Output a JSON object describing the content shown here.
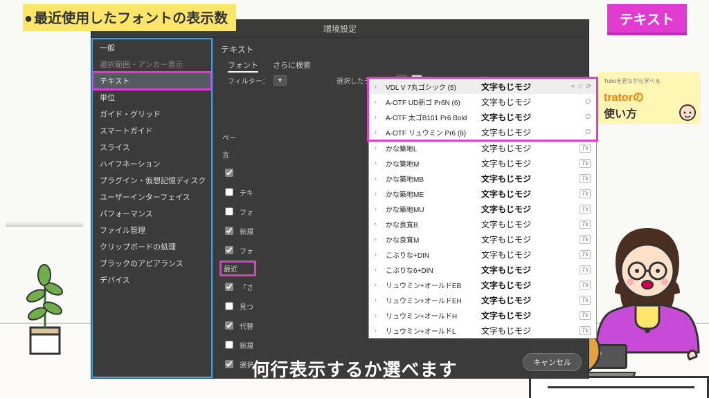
{
  "title_pill": "最近使用したフォントの表示数",
  "right_label": "テキスト",
  "app": {
    "title": "環境設定",
    "main_heading": "テキスト",
    "tabs": {
      "font": "フォント",
      "more": "さらに検索"
    },
    "filter": {
      "label": "フィルター：",
      "selected_text_label": "選択したテキスト"
    },
    "cancel": "キャンセル"
  },
  "sidebar": [
    "一般",
    "選択範囲・アンカー表示",
    "テキスト",
    "単位",
    "ガイド・グリッド",
    "スマートガイド",
    "スライス",
    "ハイフネーション",
    "プラグイン・仮想記憶ディスク",
    "ユーザーインターフェイス",
    "パフォーマンス",
    "ファイル管理",
    "クリップボードの処理",
    "ブラックのアピアランス",
    "デバイス"
  ],
  "sidebar_selected_index": 2,
  "options": [
    {
      "label": "ペー",
      "checked": false,
      "type": "text"
    },
    {
      "label": "言",
      "checked": false,
      "type": "text"
    },
    {
      "label": "",
      "checked": true
    },
    {
      "label": "テキ",
      "checked": false
    },
    {
      "label": "フォ",
      "checked": false
    },
    {
      "label": "新規",
      "checked": true
    },
    {
      "label": "フォ",
      "checked": true
    },
    {
      "label": "最近",
      "checked": false,
      "highlight": true,
      "type": "text"
    },
    {
      "label": "「さ",
      "checked": true
    },
    {
      "label": "見つ",
      "checked": false
    },
    {
      "label": "代替",
      "checked": true
    },
    {
      "label": "新規",
      "checked": false
    },
    {
      "label": "選択",
      "checked": true
    }
  ],
  "fonts": {
    "recent": [
      {
        "name": "VDL V 7丸ゴシック (5)",
        "sample": "文字もじモジ",
        "style": "sans bold",
        "tail": "≈ ☆ ⟳"
      },
      {
        "name": "A-OTF UD新ゴ Pr6N (6)",
        "sample": "文字もじモジ",
        "style": "sans",
        "tail": "O"
      },
      {
        "name": "A-OTF 太ゴB101 Pr6 Bold",
        "sample": "文字もじモジ",
        "style": "sans bold",
        "tail": "O"
      },
      {
        "name": "A-OTF リュウミン Pr6 (8)",
        "sample": "文字もじモジ",
        "style": "serif",
        "tail": "O"
      }
    ],
    "list": [
      {
        "name": "かな築地L",
        "sample": "文字もじモジ",
        "style": "serif"
      },
      {
        "name": "かな築地M",
        "sample": "文字もじモジ",
        "style": "serif"
      },
      {
        "name": "かな築地MB",
        "sample": "文字もじモジ",
        "style": "serif bold"
      },
      {
        "name": "かな築地ME",
        "sample": "文字もじモジ",
        "style": "serif bold"
      },
      {
        "name": "かな築地MU",
        "sample": "文字もじモジ",
        "style": "serif bold"
      },
      {
        "name": "かな良寛B",
        "sample": "文字もじモジ",
        "style": "serif"
      },
      {
        "name": "かな良寛M",
        "sample": "文字もじモジ",
        "style": "serif"
      },
      {
        "name": "こぶりな+DIN",
        "sample": "文字もじモジ",
        "style": "sans"
      },
      {
        "name": "こぶりな6+DIN",
        "sample": "文字もじモジ",
        "style": "sans bold"
      },
      {
        "name": "リュウミン+オールドEB",
        "sample": "文字もじモジ",
        "style": "serif bold"
      },
      {
        "name": "リュウミン+オールドEH",
        "sample": "文字もじモジ",
        "style": "serif bold"
      },
      {
        "name": "リュウミン+オールドH",
        "sample": "文字もじモジ",
        "style": "serif bold"
      },
      {
        "name": "リュウミン+オールドL",
        "sample": "文字もじモジ",
        "style": "serif"
      }
    ]
  },
  "card": {
    "sub": "Tubeを見ながら学べる",
    "main1": "tratorの",
    "main2": "使い方"
  },
  "caption": "何行表示するか選べます"
}
